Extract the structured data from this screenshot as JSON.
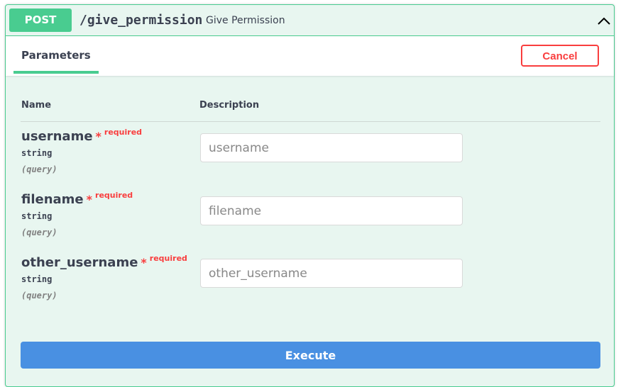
{
  "operation": {
    "method": "POST",
    "path": "/give_permission",
    "summary": "Give Permission"
  },
  "section": {
    "tab_label": "Parameters",
    "cancel_label": "Cancel"
  },
  "table": {
    "col_name": "Name",
    "col_description": "Description"
  },
  "params": [
    {
      "name": "username",
      "required_mark": "*",
      "required_text": "required",
      "type": "string",
      "location": "(query)",
      "placeholder": "username"
    },
    {
      "name": "filename",
      "required_mark": "*",
      "required_text": "required",
      "type": "string",
      "location": "(query)",
      "placeholder": "filename"
    },
    {
      "name": "other_username",
      "required_mark": "*",
      "required_text": "required",
      "type": "string",
      "location": "(query)",
      "placeholder": "other_username"
    }
  ],
  "execute_label": "Execute",
  "icons": {
    "collapse": "chevron-up-icon"
  },
  "colors": {
    "post_green": "#49cc90",
    "cancel_red": "#f93e3e",
    "execute_blue": "#4990e2",
    "text": "#3b4151"
  }
}
